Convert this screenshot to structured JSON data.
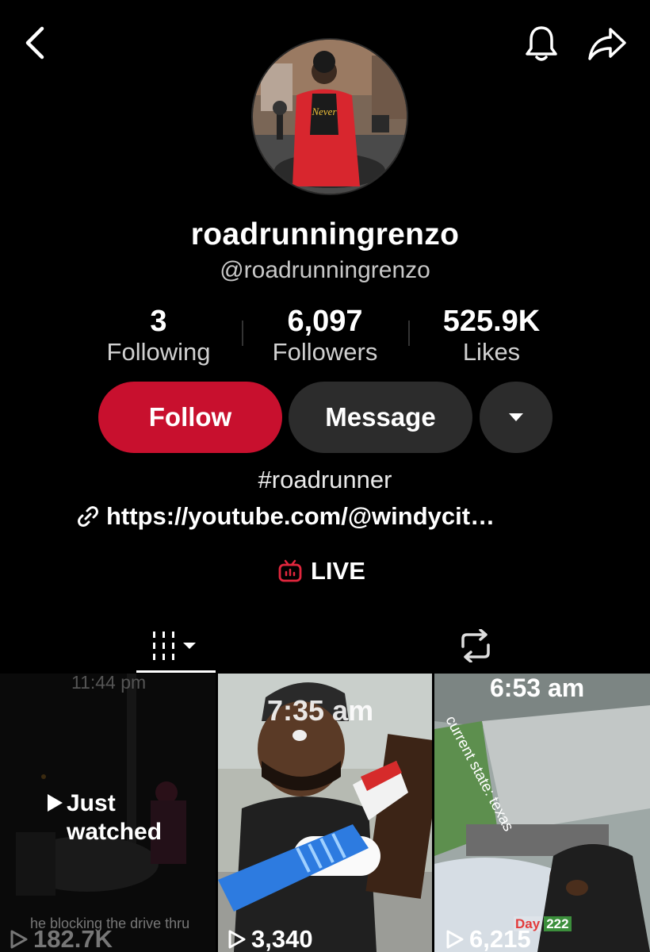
{
  "profile": {
    "display_name": "roadrunningrenzo",
    "handle": "@roadrunningrenzo",
    "bio": "#roadrunner",
    "link": "https://youtube.com/@windycit…",
    "live_label": "LIVE"
  },
  "stats": [
    {
      "value": "3",
      "label": "Following"
    },
    {
      "value": "6,097",
      "label": "Followers"
    },
    {
      "value": "525.9K",
      "label": "Likes"
    }
  ],
  "actions": {
    "follow_label": "Follow",
    "message_label": "Message"
  },
  "icons": {
    "back": "chevron-left-icon",
    "notifications": "bell-icon",
    "share": "share-arrow-icon",
    "more": "caret-down-icon",
    "link": "link-icon",
    "live": "tv-live-icon",
    "videos_tab": "grid-bars-icon",
    "reposts_tab": "repost-icon",
    "play": "play-outline-icon"
  },
  "videos": [
    {
      "time_overlay": "11:44 pm",
      "status": "Just watched",
      "caption": "he blocking the drive thru",
      "views": "182.7K"
    },
    {
      "time_overlay": "7:35 am",
      "views": "3,340"
    },
    {
      "time_overlay": "6:53 am",
      "caption": "current state: texas",
      "day_label": "Day",
      "day_number": "222",
      "views": "6,215"
    }
  ],
  "colors": {
    "background": "#000000",
    "follow_button": "#c8102e",
    "secondary_button": "#2c2c2c",
    "live_accent": "#e0263d"
  }
}
